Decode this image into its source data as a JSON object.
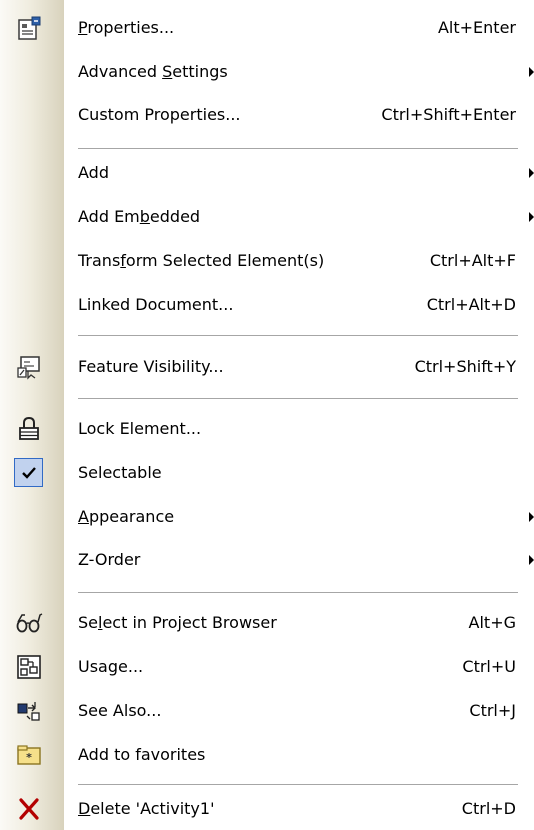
{
  "menu": {
    "properties": {
      "l1": "",
      "u": "P",
      "l2": "roperties...",
      "shortcut": "Alt+Enter",
      "icon": "properties-icon"
    },
    "advanced_settings": {
      "l1": "Advanced ",
      "u": "S",
      "l2": "ettings"
    },
    "custom_properties": {
      "label": "Custom Properties...",
      "shortcut": "Ctrl+Shift+Enter"
    },
    "add": {
      "label": "Add"
    },
    "add_embedded": {
      "l1": "Add Em",
      "u": "b",
      "l2": "edded"
    },
    "transform": {
      "l1": "Trans",
      "u": "f",
      "l2": "orm Selected Element(s)",
      "shortcut": "Ctrl+Alt+F"
    },
    "linked_document": {
      "label": "Linked Document...",
      "shortcut": "Ctrl+Alt+D"
    },
    "feature_visibility": {
      "label": "Feature Visibility...",
      "shortcut": "Ctrl+Shift+Y",
      "icon": "feature-visibility-icon"
    },
    "lock_element": {
      "label": "Lock Element...",
      "icon": "lock-icon"
    },
    "selectable": {
      "label": "Selectable",
      "checked": true,
      "icon": "checkmark-icon"
    },
    "appearance": {
      "l1": "",
      "u": "A",
      "l2": "ppearance"
    },
    "z_order": {
      "label": "Z-Order"
    },
    "select_in_browser": {
      "l1": "Se",
      "u": "l",
      "l2": "ect in Project Browser",
      "shortcut": "Alt+G",
      "icon": "glasses-icon"
    },
    "usage": {
      "label": "Usage...",
      "shortcut": "Ctrl+U",
      "icon": "usage-icon"
    },
    "see_also": {
      "label": "See Also...",
      "shortcut": "Ctrl+J",
      "icon": "see-also-icon"
    },
    "add_to_favorites": {
      "label": "Add to favorites",
      "icon": "favorites-folder-icon"
    },
    "delete": {
      "l1": "",
      "u": "D",
      "l2": "elete 'Activity1'",
      "shortcut": "Ctrl+D",
      "icon": "delete-x-icon"
    }
  }
}
